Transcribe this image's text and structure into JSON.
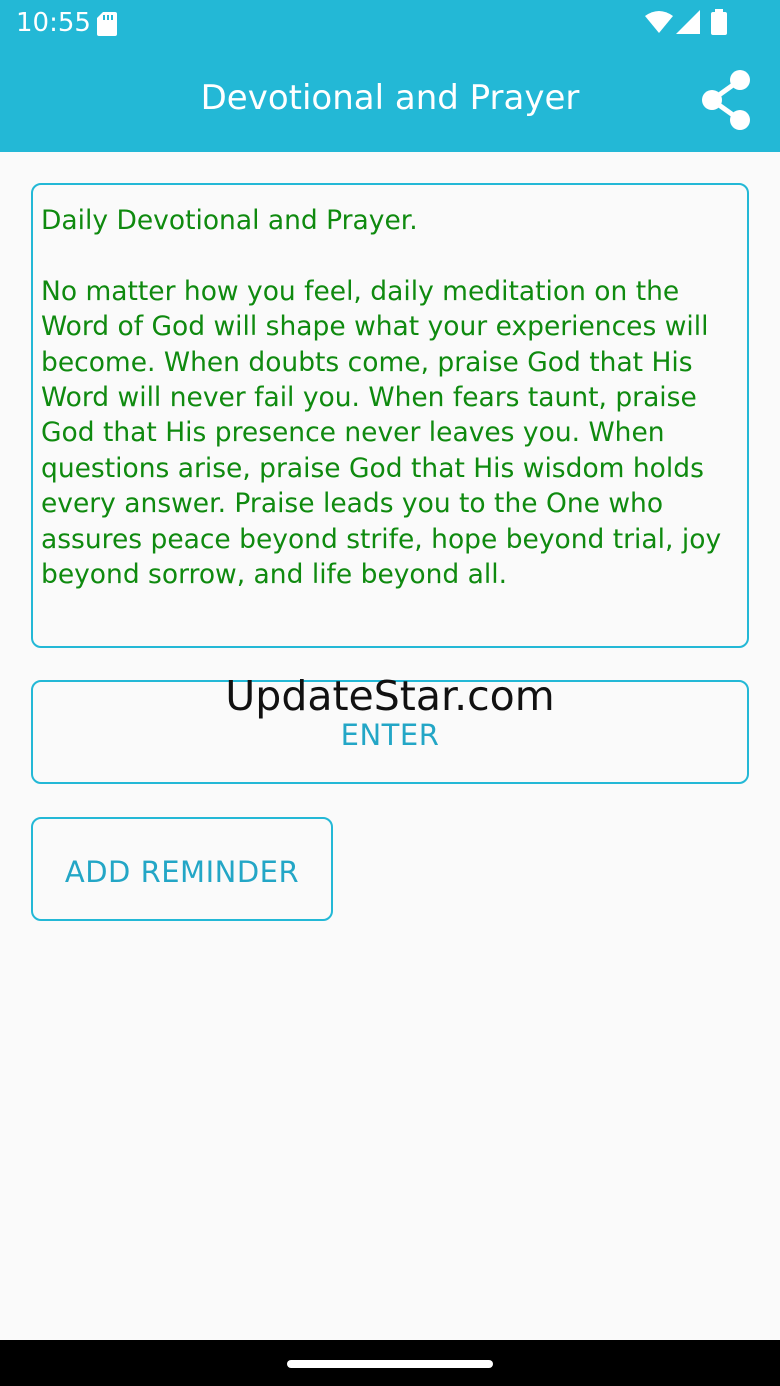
{
  "status_bar": {
    "time": "10:55",
    "icons": [
      "sd-card-icon",
      "wifi-icon",
      "signal-icon",
      "battery-icon"
    ]
  },
  "app_bar": {
    "title": "Devotional and Prayer",
    "share_icon": "share-icon"
  },
  "devotional": {
    "text": "Daily Devotional and Prayer.\n\nNo matter how you feel, daily meditation on the Word of God will shape what your experiences will become. When doubts come, praise God that His Word will never fail you. When fears taunt, praise God that His presence never leaves you. When questions arise, praise God that His wisdom holds every answer. Praise leads you to the One who assures peace beyond strife, hope beyond trial, joy beyond sorrow, and life beyond all."
  },
  "buttons": {
    "enter_label": "ENTER",
    "add_reminder_label": "ADD REMINDER"
  },
  "watermark": "UpdateStar.com",
  "colors": {
    "accent": "#23b8d6",
    "devotional_text": "#0f8a0f",
    "button_text": "#23a6c6",
    "background": "#fafafa"
  }
}
